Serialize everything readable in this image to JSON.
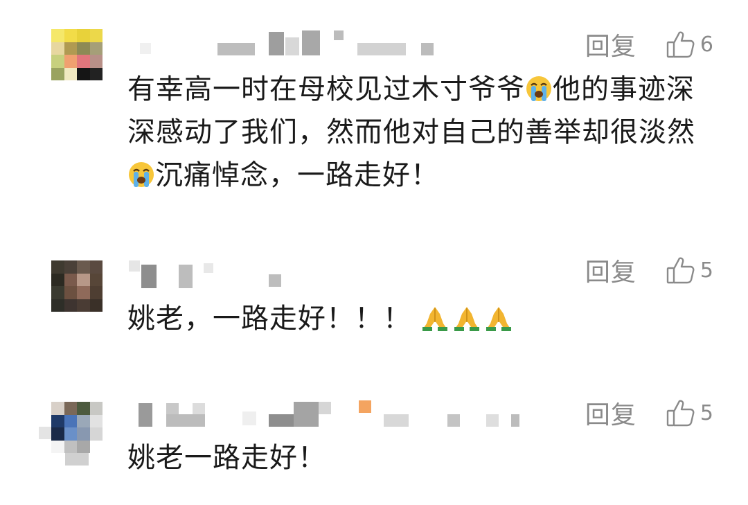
{
  "comments": [
    {
      "reply_label": "回复",
      "like_count": "6",
      "text_parts": [
        "有幸高一时在母校见过木寸爷爷",
        "他的事迹深深感动了我们，然而他对自己的善举却很淡然",
        "沉痛悼念，一路走好！"
      ],
      "emoji": [
        "loudly-crying-face",
        "loudly-crying-face"
      ]
    },
    {
      "reply_label": "回复",
      "like_count": "5",
      "text_parts": [
        "姚老，一路走好！！！ "
      ],
      "emoji": [
        "folded-hands",
        "folded-hands",
        "folded-hands"
      ]
    },
    {
      "reply_label": "回复",
      "like_count": "5",
      "text_parts": [
        "姚老一路走好！"
      ],
      "emoji": []
    }
  ],
  "colors": {
    "meta_gray": "#8a8a8a",
    "text": "#1a1a1a",
    "background": "#ffffff"
  }
}
